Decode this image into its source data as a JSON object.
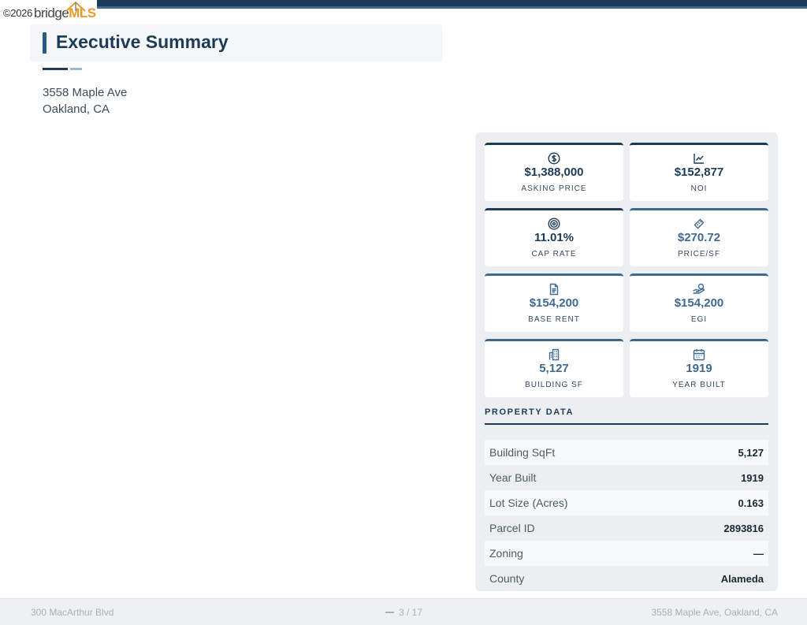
{
  "watermark": {
    "copyright": "©2026",
    "brand_a": "bridge",
    "brand_b": "MLS"
  },
  "header": {
    "title": "Executive Summary"
  },
  "address": {
    "street": "3558 Maple Ave",
    "city_state": "Oakland, CA"
  },
  "metrics": [
    {
      "icon": "dollar-circle-icon",
      "value": "$1,388,000",
      "label": "ASKING PRICE"
    },
    {
      "icon": "line-chart-icon",
      "value": "$152,877",
      "label": "NOI"
    },
    {
      "icon": "target-icon",
      "value": "11.01%",
      "label": "CAP RATE"
    },
    {
      "icon": "tag-icon",
      "value": "$270.72",
      "label": "PRICE/SF"
    },
    {
      "icon": "document-icon",
      "value": "$154,200",
      "label": "BASE RENT"
    },
    {
      "icon": "hand-coins-icon",
      "value": "$154,200",
      "label": "EGI"
    },
    {
      "icon": "building-icon",
      "value": "5,127",
      "label": "BUILDING SF"
    },
    {
      "icon": "calendar-icon",
      "value": "1919",
      "label": "YEAR BUILT"
    }
  ],
  "property_data": {
    "title": "PROPERTY DATA",
    "rows": [
      {
        "key": "Building SqFt",
        "value": "5,127"
      },
      {
        "key": "Year Built",
        "value": "1919"
      },
      {
        "key": "Lot Size (Acres)",
        "value": "0.163"
      },
      {
        "key": "Parcel ID",
        "value": "2893816"
      },
      {
        "key": "Zoning",
        "value": "—"
      },
      {
        "key": "County",
        "value": "Alameda"
      }
    ]
  },
  "footer": {
    "left": "300 MacArthur Blvd",
    "page": "3 / 17",
    "right": "3558 Maple Ave, Oakland, CA"
  },
  "colors": {
    "navy": "#1d3b57",
    "steel": "#3f6a8f",
    "panel": "#eceff1"
  }
}
